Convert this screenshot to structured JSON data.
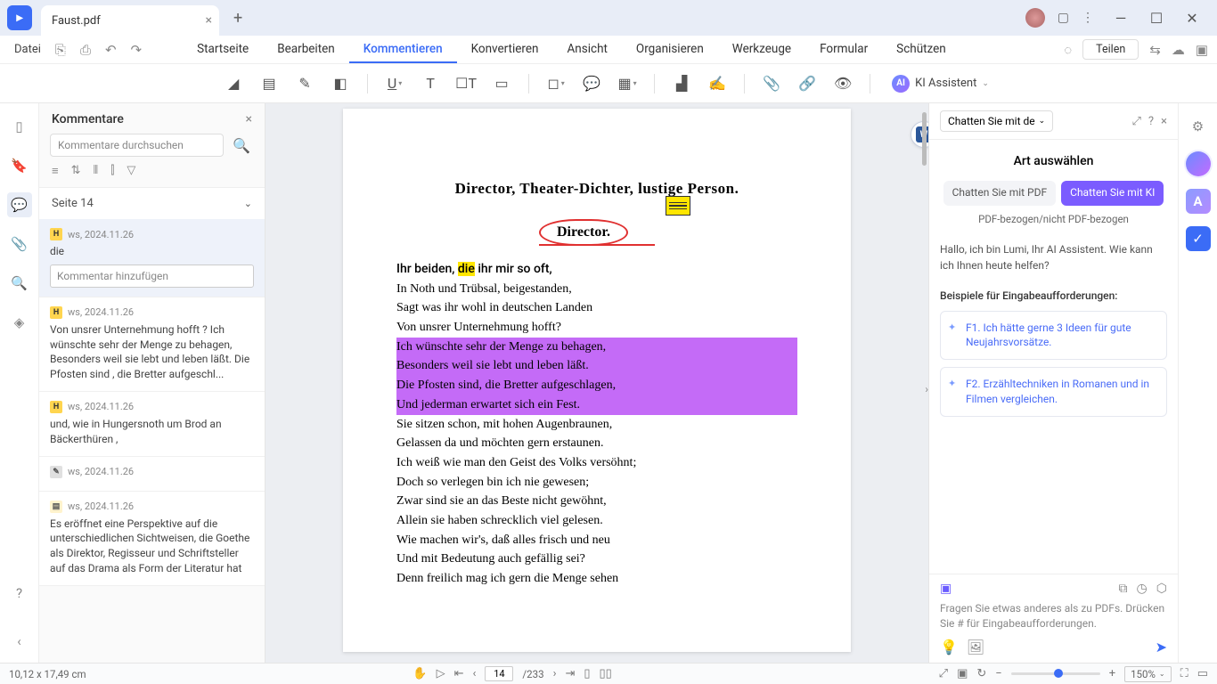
{
  "title_bar": {
    "tab_name": "Faust.pdf"
  },
  "menu": {
    "file": "Datei",
    "items": [
      "Startseite",
      "Bearbeiten",
      "Kommentieren",
      "Konvertieren",
      "Ansicht",
      "Organisieren",
      "Werkzeuge",
      "Formular",
      "Schützen"
    ],
    "active_index": 2,
    "share": "Teilen"
  },
  "ai_assist_label": "KI Assistent",
  "comments": {
    "title": "Kommentare",
    "search_placeholder": "Kommentare durchsuchen",
    "page_header": "Seite 14",
    "items": [
      {
        "type": "hl",
        "author": "ws,",
        "date": "2024.11.26",
        "body": "die",
        "selected": true,
        "input_placeholder": "Kommentar hinzufügen"
      },
      {
        "type": "hl",
        "author": "ws,",
        "date": "2024.11.26",
        "body": "Von unsrer Unternehmung hofft ?\nIch wünschte sehr der Menge zu behagen,\nBesonders weil sie lebt und leben läßt.\nDie Pfosten sind , die Bretter aufgeschl..."
      },
      {
        "type": "hl",
        "author": "ws,",
        "date": "2024.11.26",
        "body": "und, wie in Hungersnoth um Brod an Bäckerthüren ,"
      },
      {
        "type": "pen",
        "author": "ws,",
        "date": "2024.11.26",
        "body": ""
      },
      {
        "type": "note",
        "author": "ws,",
        "date": "2024.11.26",
        "body": "Es eröffnet eine Perspektive auf die unterschiedlichen Sichtweisen, die Goethe als Direktor, Regisseur und Schriftsteller auf das Drama als Form der Literatur hat"
      }
    ]
  },
  "document": {
    "heading": "Director, Theater-Dichter, lustige Person.",
    "director": "Director.",
    "lines": [
      {
        "pre": "Ihr beiden, ",
        "hl": "die",
        "post": " ihr mir so oft,",
        "style": "yellow"
      },
      {
        "pre": "In Noth und Trübsal, beigestanden,",
        "style": "none"
      },
      {
        "pre": "Sagt was ihr wohl in deutschen Landen",
        "style": "none"
      },
      {
        "pre": "Von unsrer Unternehmung hofft?",
        "style": "none"
      },
      {
        "pre": "Ich wünschte sehr der Menge zu behagen,",
        "style": "purple"
      },
      {
        "pre": "Besonders weil sie lebt und leben läßt.",
        "style": "purple"
      },
      {
        "pre": "Die Pfosten sind, die Bretter aufgeschlagen,",
        "style": "purple"
      },
      {
        "pre": "Und jederman erwartet sich ein Fest.",
        "style": "purple"
      },
      {
        "pre": "Sie sitzen schon, mit hohen Augenbraunen,",
        "style": "none"
      },
      {
        "pre": "Gelassen da und möchten gern erstaunen.",
        "style": "none"
      },
      {
        "pre": "Ich weiß wie man den Geist des Volks versöhnt;",
        "style": "none"
      },
      {
        "pre": "Doch so verlegen bin ich nie gewesen;",
        "style": "none"
      },
      {
        "pre": "Zwar sind sie an das Beste nicht gewöhnt,",
        "style": "none"
      },
      {
        "pre": "Allein sie haben schrecklich viel gelesen.",
        "style": "none"
      },
      {
        "pre": "Wie machen wir's, daß alles frisch und neu",
        "style": "none"
      },
      {
        "pre": "Und mit Bedeutung auch gefällig sei?",
        "style": "none"
      },
      {
        "pre": "Denn freilich mag ich gern die Menge sehen",
        "style": "none"
      }
    ]
  },
  "ai_panel": {
    "dropdown": "Chatten Sie mit de",
    "title": "Art auswählen",
    "tab_pdf": "Chatten Sie mit PDF",
    "tab_ki": "Chatten Sie mit KI",
    "subtitle": "PDF-bezogen/nicht PDF-bezogen",
    "greeting": "Hallo, ich bin Lumi, Ihr AI Assistent. Wie kann ich Ihnen heute helfen?",
    "examples_title": "Beispiele für Eingabeaufforderungen:",
    "examples": [
      "F1. Ich hätte gerne 3 Ideen für gute Neujahrsvorsätze.",
      "F2. Erzähltechniken in Romanen und in Filmen vergleichen."
    ],
    "input_placeholder": "Fragen Sie etwas anderes als zu PDFs. Drücken Sie # für Eingabeaufforderungen."
  },
  "status": {
    "coords": "10,12 x 17,49 cm",
    "page_current": "14",
    "page_total": "/233",
    "zoom": "150%"
  }
}
